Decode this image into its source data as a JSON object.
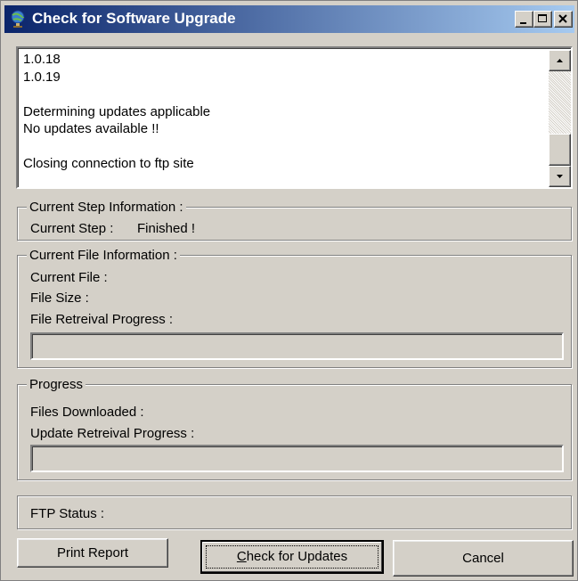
{
  "window": {
    "title": "Check for Software Upgrade",
    "controls": {
      "minimize": "_",
      "maximize": "□",
      "close": "×"
    }
  },
  "log": {
    "lines": [
      "1.0.18",
      "1.0.19",
      "",
      "Determining updates applicable",
      "No updates available !!",
      "",
      "Closing connection to ftp site",
      ""
    ]
  },
  "current_step": {
    "legend": "Current Step Information :",
    "label": "Current Step :",
    "value": "Finished !"
  },
  "current_file": {
    "legend": "Current File Information :",
    "file_label": "Current File :",
    "size_label": "File Size :",
    "progress_label": "File Retreival Progress :",
    "progress_value": 0
  },
  "progress": {
    "legend": "Progress",
    "files_label": "Files Downloaded :",
    "update_progress_label": "Update Retreival Progress :",
    "progress_value": 0
  },
  "ftp": {
    "label": "FTP Status :"
  },
  "buttons": {
    "print": "Print Report",
    "check_prefix": "C",
    "check_rest": "heck for Updates",
    "cancel": "Cancel"
  },
  "colors": {
    "title_start": "#0a246a",
    "title_end": "#a6caf0",
    "selection": "#0a246a",
    "face": "#d4d0c8"
  }
}
